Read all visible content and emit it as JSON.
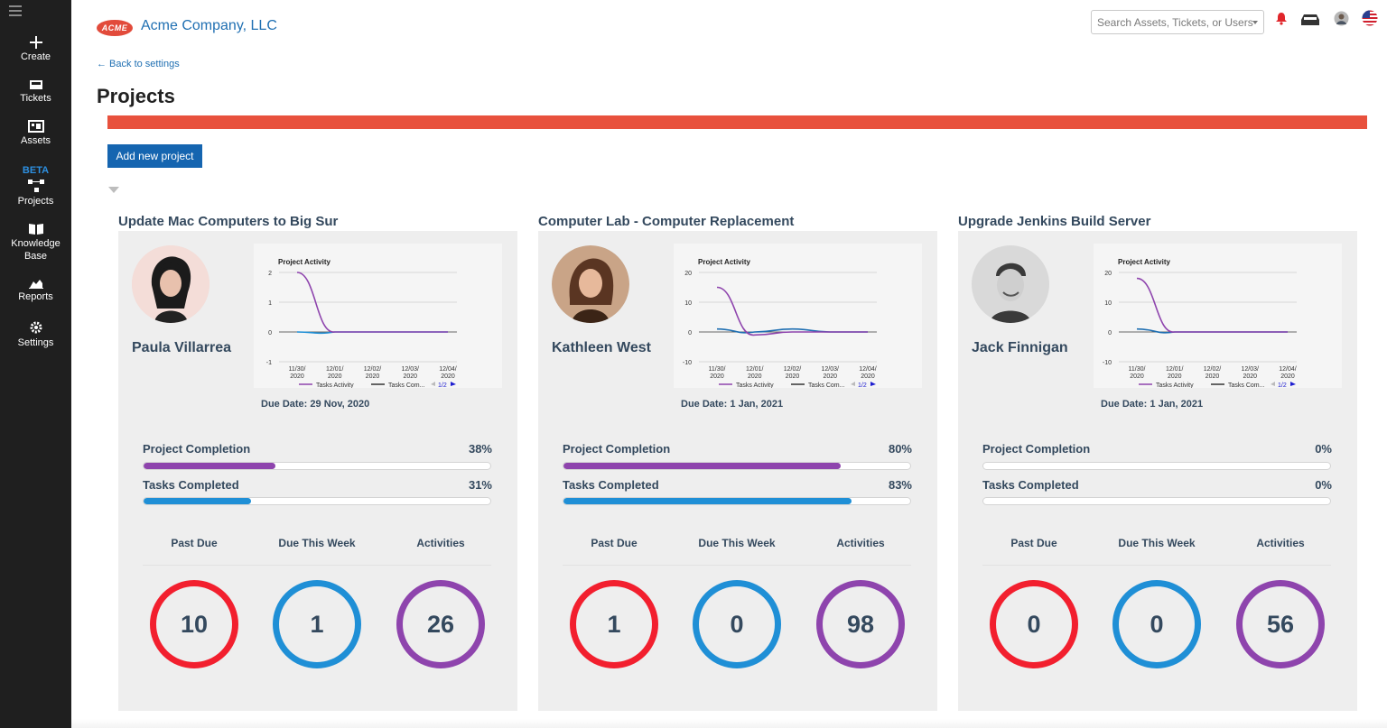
{
  "sidebar": {
    "items": [
      {
        "label": "Create",
        "icon": "plus-icon"
      },
      {
        "label": "Tickets",
        "icon": "ticket-icon"
      },
      {
        "label": "Assets",
        "icon": "assets-icon"
      },
      {
        "label": "Projects",
        "icon": "projects-icon",
        "badge": "BETA"
      },
      {
        "label": "Knowledge Base",
        "icon": "book-icon"
      },
      {
        "label": "Reports",
        "icon": "reports-icon"
      },
      {
        "label": "Settings",
        "icon": "gear-icon"
      }
    ]
  },
  "header": {
    "logo_text": "ACME",
    "company": "Acme Company, LLC",
    "search_placeholder": "Search Assets, Tickets, or Users"
  },
  "page": {
    "back_link": "← Back to settings",
    "title": "Projects",
    "add_button": "Add new project"
  },
  "labels": {
    "chart_title": "Project Activity",
    "legend_a": "Tasks Activity",
    "legend_b": "Tasks Com...",
    "legend_page": "1/2",
    "completion": "Project Completion",
    "tasks": "Tasks Completed",
    "past_due": "Past Due",
    "due_week": "Due This Week",
    "activities": "Activities"
  },
  "colors": {
    "accent_red": "#e8513d",
    "purple": "#8e44ad",
    "blue": "#1f8fd6",
    "ring_red": "#f21f2e",
    "ring_blue": "#1f8fd6",
    "ring_purple": "#8e44ad"
  },
  "projects": [
    {
      "title": "Update Mac Computers to Big Sur",
      "owner": "Paula Villarrea",
      "due": "Due Date: 29 Nov, 2020",
      "completion_pct": "38%",
      "completion": 0.38,
      "tasks_pct": "31%",
      "tasks": 0.31,
      "past_due": "10",
      "due_week": "1",
      "activities": "26"
    },
    {
      "title": "Computer Lab - Computer Replacement",
      "owner": "Kathleen West",
      "due": "Due Date: 1 Jan, 2021",
      "completion_pct": "80%",
      "completion": 0.8,
      "tasks_pct": "83%",
      "tasks": 0.83,
      "past_due": "1",
      "due_week": "0",
      "activities": "98"
    },
    {
      "title": "Upgrade Jenkins Build Server",
      "owner": "Jack Finnigan",
      "due": "Due Date: 1 Jan, 2021",
      "completion_pct": "0%",
      "completion": 0,
      "tasks_pct": "0%",
      "tasks": 0,
      "past_due": "0",
      "due_week": "0",
      "activities": "56"
    }
  ],
  "chart_data": [
    {
      "type": "line",
      "title": "Project Activity",
      "x": [
        "11/30/2020",
        "12/01/2020",
        "12/02/2020",
        "12/03/2020",
        "12/04/2020"
      ],
      "yticks": [
        2,
        1,
        0,
        -1
      ],
      "ylim": [
        -1,
        2
      ],
      "series": [
        {
          "name": "Tasks Activity",
          "color": "#8e44ad",
          "values": [
            2,
            0,
            0,
            0,
            0
          ]
        },
        {
          "name": "Tasks Com...",
          "color": "#1f8fd6",
          "values": [
            0,
            0,
            0,
            0,
            0
          ]
        }
      ]
    },
    {
      "type": "line",
      "title": "Project Activity",
      "x": [
        "11/30/2020",
        "12/01/2020",
        "12/02/2020",
        "12/03/2020",
        "12/04/2020"
      ],
      "yticks": [
        20,
        10,
        0,
        -10
      ],
      "ylim": [
        -10,
        20
      ],
      "series": [
        {
          "name": "Tasks Activity",
          "color": "#8e44ad",
          "values": [
            15,
            -1,
            0,
            0,
            0
          ]
        },
        {
          "name": "Tasks Com...",
          "color": "#1f6fb2",
          "values": [
            1,
            0,
            1,
            0,
            0
          ]
        }
      ]
    },
    {
      "type": "line",
      "title": "Project Activity",
      "x": [
        "11/30/2020",
        "12/01/2020",
        "12/02/2020",
        "12/03/2020",
        "12/04/2020"
      ],
      "yticks": [
        20,
        10,
        0,
        -10
      ],
      "ylim": [
        -10,
        20
      ],
      "series": [
        {
          "name": "Tasks Activity",
          "color": "#8e44ad",
          "values": [
            18,
            0,
            0,
            0,
            0
          ]
        },
        {
          "name": "Tasks Com...",
          "color": "#1f6fb2",
          "values": [
            1,
            0,
            0,
            0,
            0
          ]
        }
      ]
    }
  ]
}
